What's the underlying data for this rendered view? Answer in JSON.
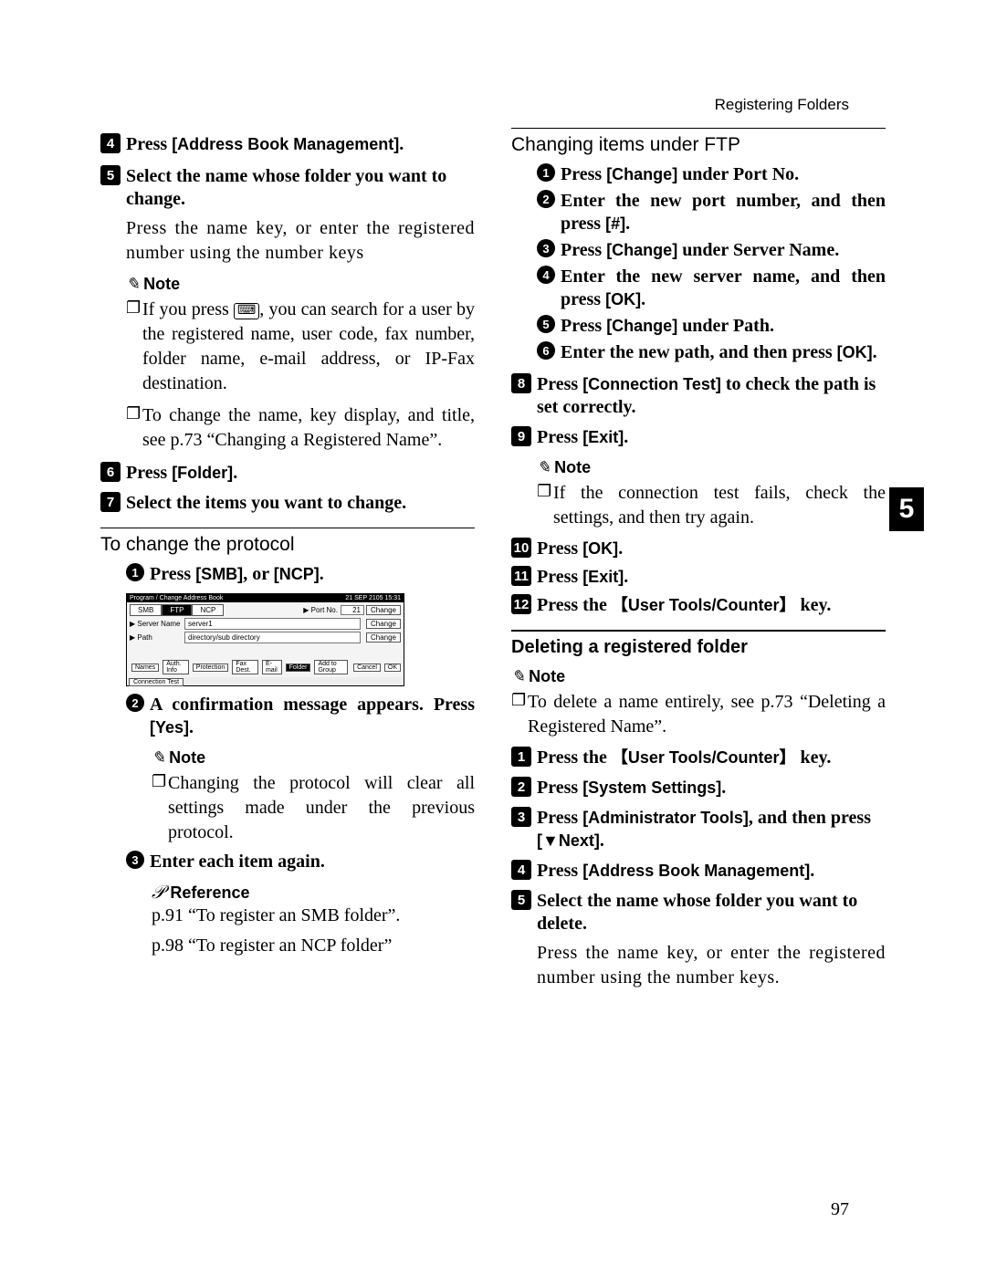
{
  "header": {
    "title": "Registering Folders"
  },
  "page_number": "97",
  "side_tab": "5",
  "icons": {
    "pencil": "✎",
    "square_bullet": "❐",
    "ref": "𝒫",
    "key_sym": "⌨",
    "down_arrow": "▼"
  },
  "labels": {
    "note": "Note",
    "reference": "Reference"
  },
  "left": {
    "s4": {
      "pre": "Press ",
      "btn": "[Address Book Management]",
      "post": "."
    },
    "s5": {
      "title": "Select the name whose folder you want to change.",
      "body": "Press the name key, or enter the registered number using the number keys"
    },
    "note1": {
      "b1a": "If you press ",
      "b1b": ", you can search for a user by the registered name, user code, fax number, folder name, e-mail address, or IP-Fax destination.",
      "b2": "To change the name, key display, and title, see p.73 “Changing a Registered Name”."
    },
    "s6": {
      "pre": "Press ",
      "btn": "[Folder]",
      "post": "."
    },
    "s7": {
      "title": "Select the items you want to change."
    },
    "protocol": {
      "title": "To change the protocol",
      "a": {
        "pre": "Press ",
        "btn": "[SMB]",
        "mid": ", or ",
        "btn2": "[NCP]",
        "post": "."
      },
      "b": {
        "text": "A confirmation message appears. Press ",
        "btn": "[Yes]",
        "post": "."
      },
      "note_b": "Changing the protocol will clear all settings made under the previous protocol.",
      "c": "Enter each item again.",
      "ref1": "p.91 “To register an SMB folder”.",
      "ref2": "p.98 “To register an NCP folder”"
    },
    "screenshot": {
      "titlebar_left": "Program / Change Address Book",
      "titlebar_right": "21 SEP  2105 15:31",
      "tab_smb": "SMB",
      "tab_ftp": "FTP",
      "tab_ncp": "NCP",
      "port_label": "▶ Port No.",
      "port_value": "21",
      "server_label": "▶ Server Name",
      "server_value": "server1",
      "path_label": "▶ Path",
      "path_value": "directory/sub directory",
      "change": "Change",
      "conn_test": "Connection Test",
      "bottom": [
        "Names",
        "Auth. Info",
        "Protection",
        "Fax Dest.",
        "E-mail",
        "Folder",
        "Add to Group",
        "Cancel",
        "OK"
      ]
    }
  },
  "right": {
    "ftp_title": "Changing items under FTP",
    "f1": {
      "pre": "Press ",
      "btn": "[Change]",
      "post": " under Port No."
    },
    "f2": {
      "text": "Enter the new port number, and then press ",
      "btn": "[#]",
      "post": "."
    },
    "f3": {
      "pre": "Press ",
      "btn": "[Change]",
      "post": " under Server Name."
    },
    "f4": {
      "text": "Enter the new server name, and then press ",
      "btn": "[OK]",
      "post": "."
    },
    "f5": {
      "pre": "Press ",
      "btn": "[Change]",
      "post": " under Path."
    },
    "f6": {
      "text": "Enter the new path, and then press ",
      "btn": "[OK]",
      "post": "."
    },
    "s8": {
      "pre": "Press ",
      "btn": "[Connection Test]",
      "post": " to check the path is set correctly."
    },
    "s9": {
      "pre": "Press ",
      "btn": "[Exit]",
      "post": "."
    },
    "note2": "If the connection test fails, check the settings, and then try again.",
    "s10": {
      "pre": "Press ",
      "btn": "[OK]",
      "post": "."
    },
    "s11": {
      "pre": "Press ",
      "btn": "[Exit]",
      "post": "."
    },
    "s12": {
      "pre": "Press the ",
      "key": "【User Tools/Counter】",
      "post": " key."
    },
    "del_title": "Deleting a registered folder",
    "del_note": "To delete a name entirely, see p.73 “Deleting a Registered Name”.",
    "d1": {
      "pre": "Press the ",
      "key": "【User Tools/Counter】",
      "post": " key."
    },
    "d2": {
      "pre": "Press ",
      "btn": "[System Settings]",
      "post": "."
    },
    "d3": {
      "pre": "Press ",
      "btn": "[Administrator Tools]",
      "mid": ", and then press ",
      "btn2_pre": "[",
      "btn2_arrow": "▼",
      "btn2_post": "Next]",
      "post": "."
    },
    "d4": {
      "pre": "Press ",
      "btn": "[Address Book Management]",
      "post": "."
    },
    "d5": {
      "title": "Select the name whose folder you want to delete.",
      "body": "Press the name key, or enter the registered number using the number keys."
    }
  }
}
